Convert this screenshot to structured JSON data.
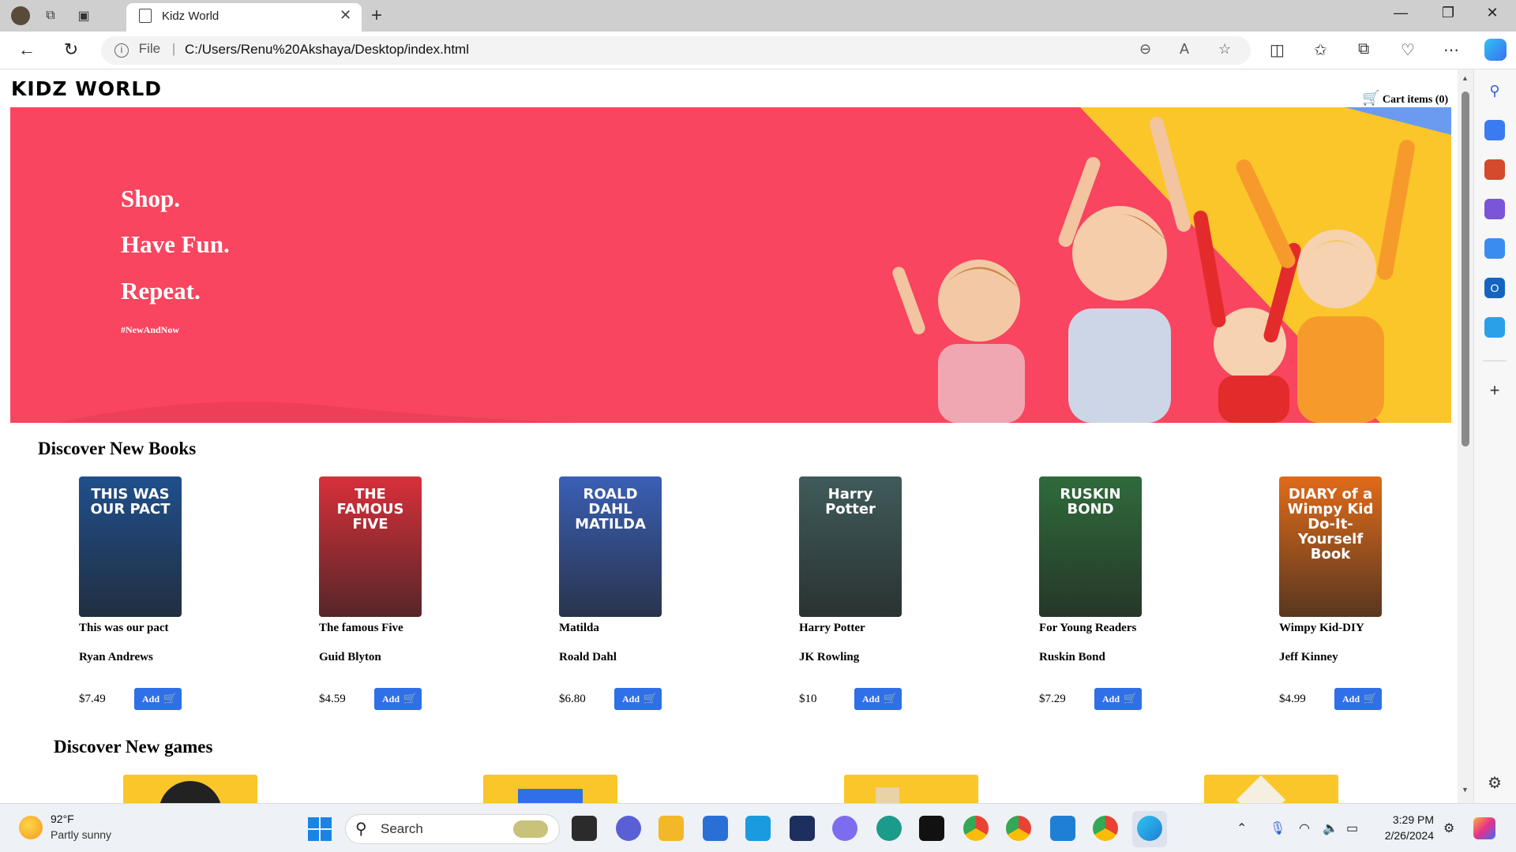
{
  "browser": {
    "tab_title": "Kidz World",
    "file_label": "File",
    "url": "C:/Users/Renu%20Akshaya/Desktop/index.html"
  },
  "site": {
    "logo": "KIDZ WORLD",
    "cart_label": "Cart items (0)",
    "hero": {
      "line1": "Shop.",
      "line2": "Have Fun.",
      "line3": "Repeat.",
      "tag": "#NewAndNow",
      "background": "#f9455f"
    },
    "books_heading": "Discover New Books",
    "games_heading": "Discover New games",
    "add_label": "Add",
    "books": [
      {
        "title": "This was our pact",
        "author": "Ryan Andrews",
        "price": "$7.49",
        "cover_text": "THIS WAS OUR PACT",
        "cover_color": "#1f4f8c"
      },
      {
        "title": "The famous Five",
        "author": "Guid Blyton",
        "price": "$4.59",
        "cover_text": "THE FAMOUS FIVE",
        "cover_color": "#d8303a"
      },
      {
        "title": "Matilda",
        "author": "Roald Dahl",
        "price": "$6.80",
        "cover_text": "ROALD DAHL MATILDA",
        "cover_color": "#3a5fb5"
      },
      {
        "title": "Harry Potter",
        "author": "JK Rowling",
        "price": "$10",
        "cover_text": "Harry Potter",
        "cover_color": "#3f5b5a"
      },
      {
        "title": "For Young Readers",
        "author": "Ruskin Bond",
        "price": "$7.29",
        "cover_text": "RUSKIN BOND",
        "cover_color": "#2f6b3b"
      },
      {
        "title": "Wimpy Kid-DIY",
        "author": "Jeff Kinney",
        "price": "$4.99",
        "cover_text": "DIARY of a Wimpy Kid Do-It-Yourself Book",
        "cover_color": "#e06b1a"
      }
    ]
  },
  "taskbar": {
    "weather_temp": "92°F",
    "weather_desc": "Partly sunny",
    "search_label": "Search",
    "time": "3:29 PM",
    "date": "2/26/2024"
  },
  "colors": {
    "accent": "#2f6fe8",
    "hero_yellow": "#fbc62a",
    "hero_blue": "#6a9bf0"
  }
}
